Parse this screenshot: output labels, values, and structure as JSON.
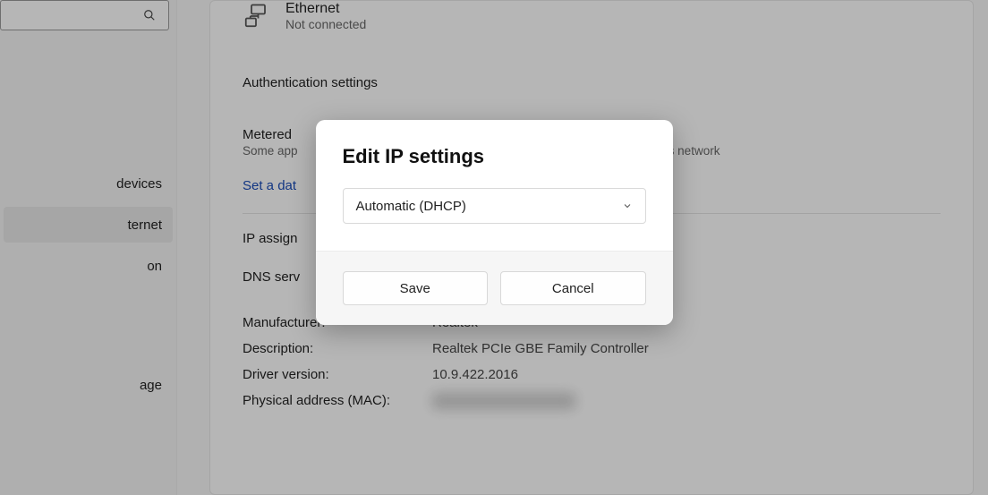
{
  "sidebar": {
    "items": [
      {
        "label": "devices"
      },
      {
        "label": "ternet"
      },
      {
        "label": "on"
      },
      {
        "label": "age"
      }
    ],
    "active_index": 1
  },
  "network": {
    "name": "Ethernet",
    "status": "Not connected"
  },
  "sections": {
    "auth": "Authentication settings",
    "metered_title": "Metered",
    "metered_sub": "Some app                                                                                     connected to this network",
    "data_limit": "Set a dat",
    "ip_assign": "IP assign",
    "dns_serv": "DNS serv"
  },
  "details": [
    {
      "label": "Manufacturer:",
      "value": "Realtek"
    },
    {
      "label": "Description:",
      "value": "Realtek PCIe GBE Family Controller"
    },
    {
      "label": "Driver version:",
      "value": "10.9.422.2016"
    },
    {
      "label": "Physical address (MAC):",
      "value": ""
    }
  ],
  "modal": {
    "title": "Edit IP settings",
    "dropdown_value": "Automatic (DHCP)",
    "save_label": "Save",
    "cancel_label": "Cancel"
  }
}
